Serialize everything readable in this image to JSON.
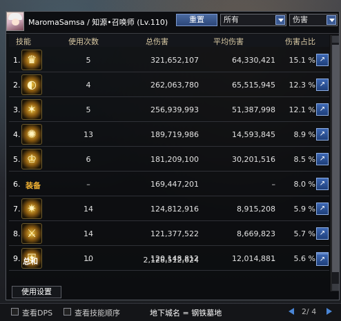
{
  "header": {
    "title": "MaromaSamsa / 知源•召唤师 (Lv.110)",
    "reset_label": "重置",
    "filter_select": "所有",
    "metric_select": "伤害"
  },
  "columns": {
    "skill": "技能",
    "uses": "使用次数",
    "total": "总伤害",
    "avg": "平均伤害",
    "pct": "伤害占比"
  },
  "rows": [
    {
      "idx": "1.",
      "uses": "5",
      "total": "321,652,107",
      "avg": "64,330,421",
      "pct": "15.1 %"
    },
    {
      "idx": "2.",
      "uses": "4",
      "total": "262,063,780",
      "avg": "65,515,945",
      "pct": "12.3 %"
    },
    {
      "idx": "3.",
      "uses": "5",
      "total": "256,939,993",
      "avg": "51,387,998",
      "pct": "12.1 %"
    },
    {
      "idx": "4.",
      "uses": "13",
      "total": "189,719,986",
      "avg": "14,593,845",
      "pct": "8.9 %"
    },
    {
      "idx": "5.",
      "uses": "6",
      "total": "181,209,100",
      "avg": "30,201,516",
      "pct": "8.5 %"
    },
    {
      "idx": "6.",
      "equip": "装备",
      "uses": "–",
      "total": "169,447,201",
      "avg": "–",
      "pct": "8.0 %"
    },
    {
      "idx": "7.",
      "uses": "14",
      "total": "124,812,916",
      "avg": "8,915,208",
      "pct": "5.9 %"
    },
    {
      "idx": "8.",
      "uses": "14",
      "total": "121,377,522",
      "avg": "8,669,823",
      "pct": "5.7 %"
    },
    {
      "idx": "9.",
      "uses": "10",
      "total": "120,148,812",
      "avg": "12,014,881",
      "pct": "5.6 %"
    }
  ],
  "summary": {
    "label": "总和",
    "uses": "–",
    "total": "2,128,512,624",
    "avg": "–"
  },
  "footer_tab": "使用设置",
  "bottom": {
    "check_dps": "查看DPS",
    "check_order": "查看技能顺序",
    "dungeon": "地下城名 = 钢铁墓地",
    "page": "2/ 4"
  },
  "icons": {
    "share": "share-icon",
    "skills": [
      "skill-icon-1",
      "skill-icon-2",
      "skill-icon-3",
      "skill-icon-4",
      "skill-icon-5",
      "skill-icon-7",
      "skill-icon-8",
      "skill-icon-9"
    ]
  }
}
